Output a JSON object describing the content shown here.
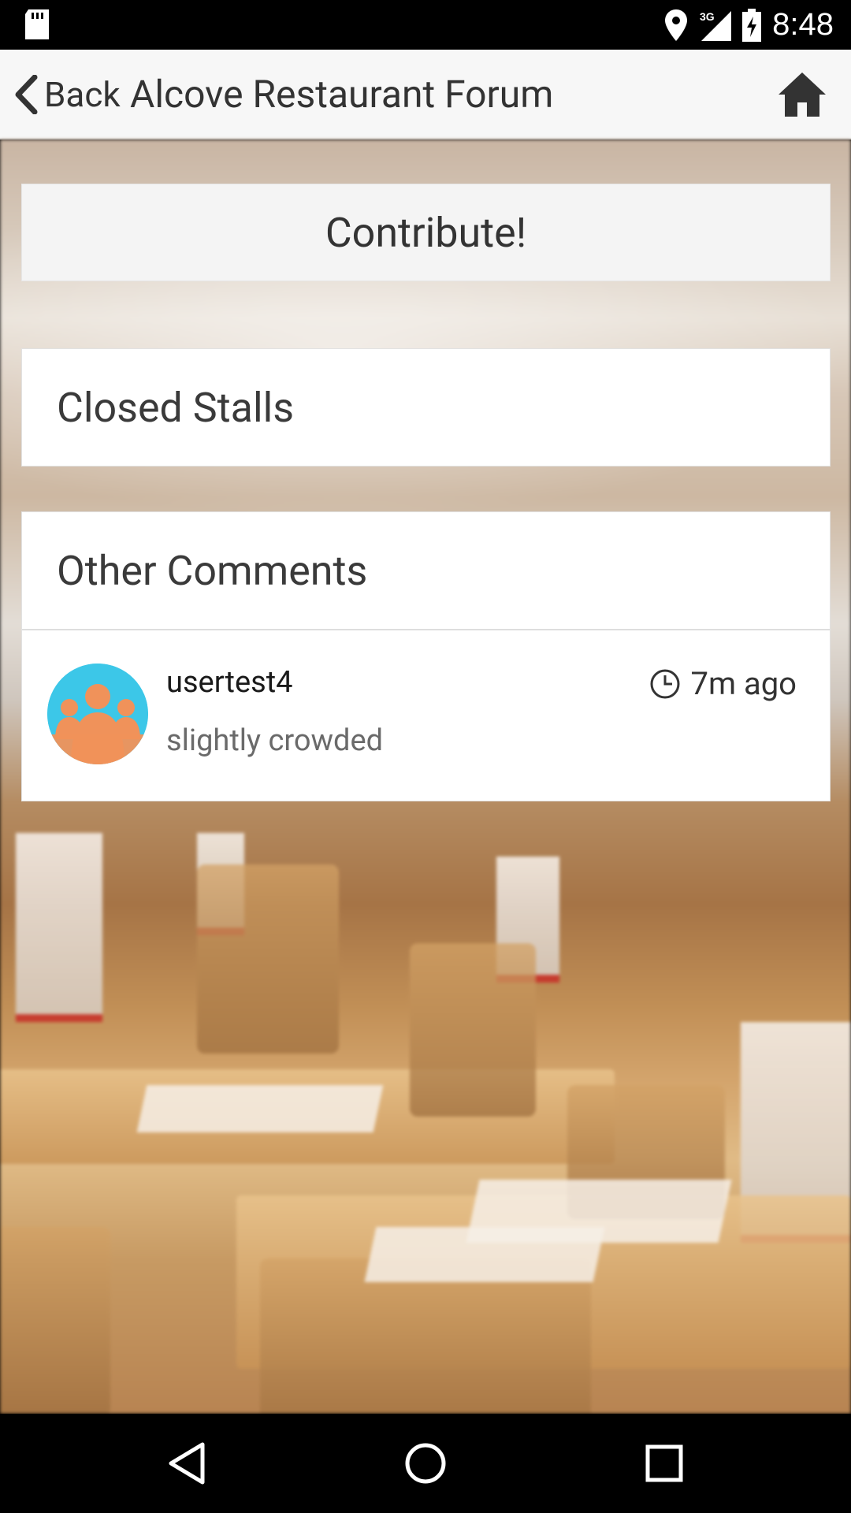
{
  "status_bar": {
    "time": "8:48",
    "network": "3G",
    "icons": [
      "sd-card-icon",
      "location-pin-icon",
      "signal-3g-icon",
      "battery-charging-icon"
    ]
  },
  "app_bar": {
    "back_label": "Back",
    "title": "Alcove Restaurant Forum",
    "home_icon": "home-icon"
  },
  "main": {
    "contribute_label": "Contribute!",
    "closed_stalls_title": "Closed Stalls",
    "other_comments_title": "Other Comments",
    "comments": [
      {
        "user": "usertest4",
        "text": "slightly crowded",
        "time": "7m ago",
        "avatar_icon": "group-avatar-icon"
      }
    ]
  },
  "nav_bar": {
    "icons": [
      "back-triangle-icon",
      "home-circle-icon",
      "recents-square-icon"
    ]
  },
  "colors": {
    "app_bar_bg": "#f7f7f7",
    "avatar_bg": "#3cc7e8",
    "avatar_figure": "#f0925a",
    "status_bar_bg": "#000000"
  }
}
